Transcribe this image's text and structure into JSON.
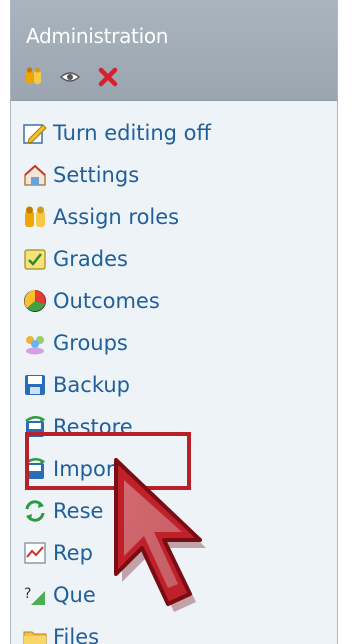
{
  "block": {
    "title": "Administration",
    "header_icons": [
      "assign-roles-icon",
      "eye-icon",
      "delete-x-icon"
    ],
    "items": [
      {
        "label": "Turn editing off",
        "icon": "edit-icon"
      },
      {
        "label": "Settings",
        "icon": "settings-icon"
      },
      {
        "label": "Assign roles",
        "icon": "assign-roles-icon"
      },
      {
        "label": "Grades",
        "icon": "grades-icon"
      },
      {
        "label": "Outcomes",
        "icon": "outcomes-icon"
      },
      {
        "label": "Groups",
        "icon": "groups-icon"
      },
      {
        "label": "Backup",
        "icon": "backup-icon"
      },
      {
        "label": "Restore",
        "icon": "restore-icon"
      },
      {
        "label": "Import",
        "icon": "import-icon"
      },
      {
        "label": "Rese",
        "icon": "reset-icon"
      },
      {
        "label": "Rep",
        "icon": "reports-icon"
      },
      {
        "label": "Que",
        "icon": "questions-icon"
      },
      {
        "label": "Files",
        "icon": "files-icon"
      }
    ]
  },
  "colors": {
    "header_bg": "#a0abb6",
    "panel_bg": "#eef3f8",
    "link": "#1f5f9a",
    "highlight": "#b8202a"
  }
}
